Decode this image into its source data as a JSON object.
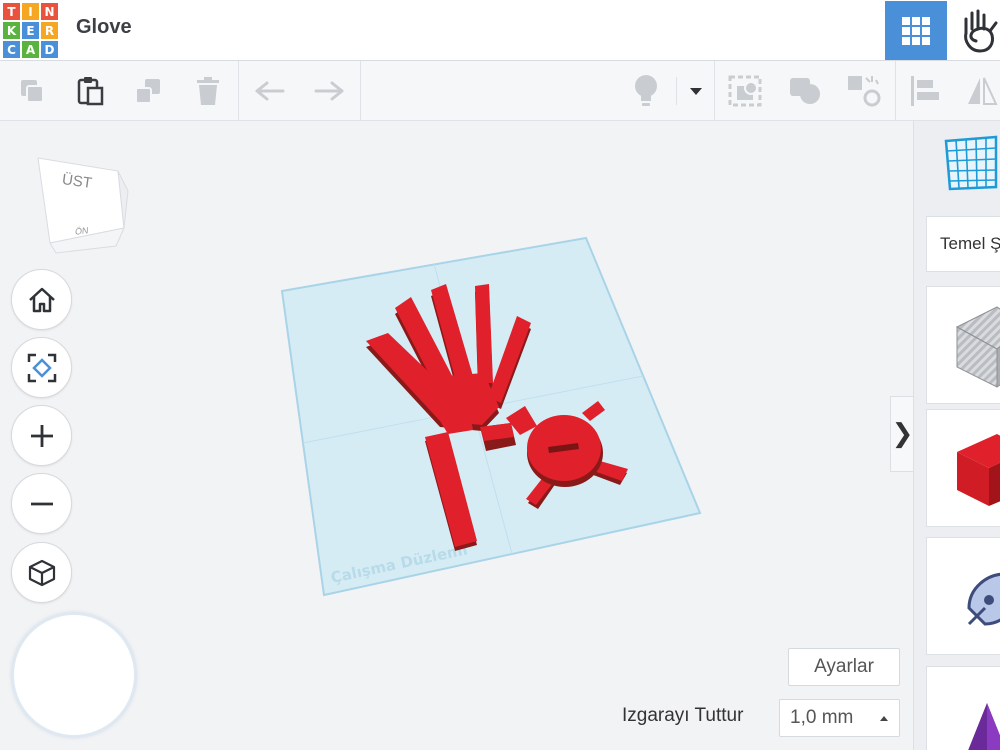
{
  "app": {
    "logo_letters": [
      "T",
      "I",
      "N",
      "K",
      "E",
      "R",
      "C",
      "A",
      "D"
    ],
    "logo_colors": [
      "#e9533d",
      "#f5a623",
      "#e9533d",
      "#5ab33e",
      "#4a90d9",
      "#f5a623",
      "#4a90d9",
      "#5ab33e",
      "#4a90d9"
    ],
    "document_title": "Glove"
  },
  "header": {
    "grid_view_icon": "grid-icon",
    "hand_icon": "hand-icon",
    "accent_color": "#4a90d9"
  },
  "toolbar": {
    "icons": [
      "copy-icon",
      "paste-icon",
      "duplicate-icon",
      "delete-icon",
      "undo-icon",
      "redo-icon",
      "lightbulb-icon",
      "dropdown-arrow-icon",
      "workplane-icon",
      "group-icon",
      "ungroup-icon",
      "align-icon",
      "mirror-icon"
    ]
  },
  "viewcube": {
    "top_label": "ÜST",
    "front_label": "ÖN"
  },
  "workspace": {
    "workplane_label": "Çalışma Düzlemi",
    "shape_color": "#e02020",
    "settings_label": "Ayarlar",
    "snap_label": "Izgarayı Tuttur",
    "snap_value": "1,0 mm"
  },
  "right_panel": {
    "library_label": "Temel Şekiller",
    "toggle_glyph": "❯"
  }
}
